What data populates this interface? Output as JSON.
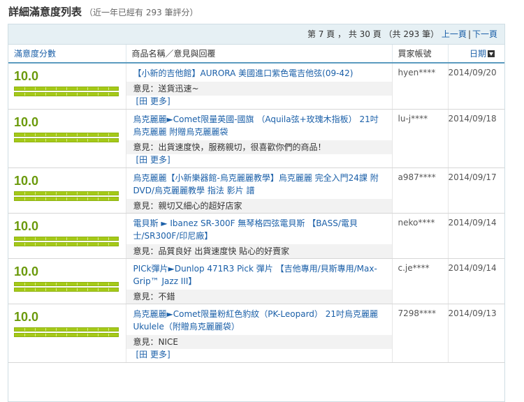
{
  "heading": {
    "title": "詳細滿意度列表",
    "subtitle": "（近一年已經有 293 筆評分）"
  },
  "pager": {
    "summary": "第 7 頁 ， 共 30 頁 （共 293 筆）",
    "prev_label": "上一頁",
    "separator": "|",
    "next_label": "下一頁"
  },
  "columns": {
    "score": "滿意度分數",
    "product": "商品名稱／意見與回覆",
    "buyer": "買家帳號",
    "date": "日期"
  },
  "icons": {
    "sort": "sort-down-icon",
    "more": "plus-box-icon"
  },
  "colors": {
    "accent": "#1a5fa8",
    "score": "#6b9a0c",
    "bar": "#a5c918",
    "header_bg": "#e6f0f4"
  },
  "reviews": [
    {
      "score": "10.0",
      "rating_fraction": 1.0,
      "product": "【小新的吉他館】AURORA 美國進口紫色電吉他弦(09-42)",
      "comment": "意見：送貨迅速~",
      "more": "[田 更多]",
      "buyer": "hyen****",
      "date": "2014/09/20"
    },
    {
      "score": "10.0",
      "rating_fraction": 1.0,
      "product": "烏克麗麗►Comet限量英國-國旗 （Aquila弦+玫瑰木指板） 21吋烏克麗麗 附贈烏克麗麗袋",
      "comment": "意見：出貨速度快，服務親切，很喜歡你們的商品！",
      "more": "[田 更多]",
      "buyer": "lu-j****",
      "date": "2014/09/18"
    },
    {
      "score": "10.0",
      "rating_fraction": 1.0,
      "product": "烏克麗麗【小新樂器館-烏克麗麗教學】烏克麗麗 完全入門24課 附 DVD/烏克麗麗教學 指法 影片 譜",
      "comment": "意見：親切又細心的超好店家",
      "more": "",
      "buyer": "a987****",
      "date": "2014/09/17"
    },
    {
      "score": "10.0",
      "rating_fraction": 1.0,
      "product": "電貝斯 ► Ibanez SR-300F 無琴格四弦電貝斯 【BASS/電貝士/SR300F/印尼廠】",
      "comment": "意見：品質良好 出貨速度快 貼心的好賣家",
      "more": "",
      "buyer": "neko****",
      "date": "2014/09/14"
    },
    {
      "score": "10.0",
      "rating_fraction": 1.0,
      "product": "PICk彈片►Dunlop 471R3 Pick 彈片 【吉他專用/貝斯專用/Max-Grip™ Jazz III】",
      "comment": "意見：不錯",
      "more": "",
      "buyer": "c.je****",
      "date": "2014/09/14"
    },
    {
      "score": "10.0",
      "rating_fraction": 1.0,
      "product": "烏克麗麗►Comet限量粉紅色豹紋（PK-Leopard） 21吋烏克麗麗 Ukulele（附贈烏克麗麗袋）",
      "comment": "意見：NICE",
      "more": "[田 更多]",
      "buyer": "7298****",
      "date": "2014/09/13"
    }
  ]
}
